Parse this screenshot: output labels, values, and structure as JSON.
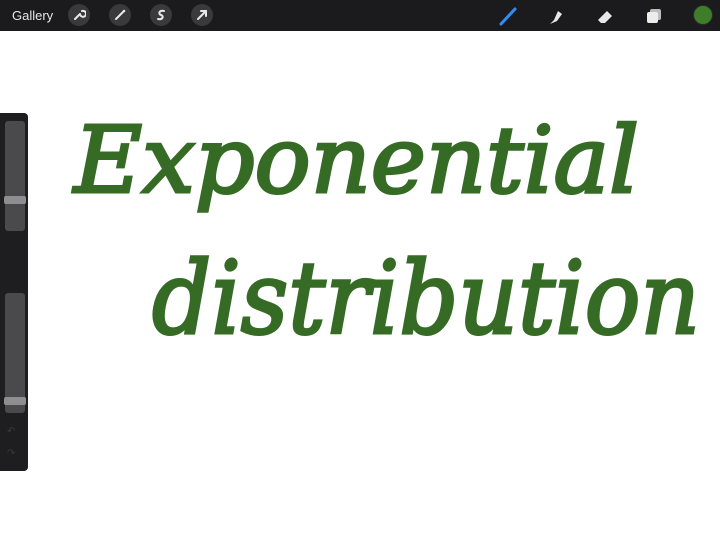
{
  "toolbar": {
    "gallery_label": "Gallery",
    "left_tools": [
      "wrench-icon",
      "magic-wand-icon",
      "selection-icon",
      "transform-arrow-icon"
    ],
    "right_tools": [
      "brush-icon",
      "smudge-icon",
      "eraser-icon",
      "layers-icon"
    ],
    "active_tool": "brush-icon",
    "active_color": "#3e7d2a"
  },
  "sidebar": {
    "brush_size": 0.26,
    "brush_opacity": 0.07
  },
  "canvas": {
    "handwriting_line1": "Exponential",
    "handwriting_line2": "distribution",
    "ink_color": "#356b24"
  }
}
